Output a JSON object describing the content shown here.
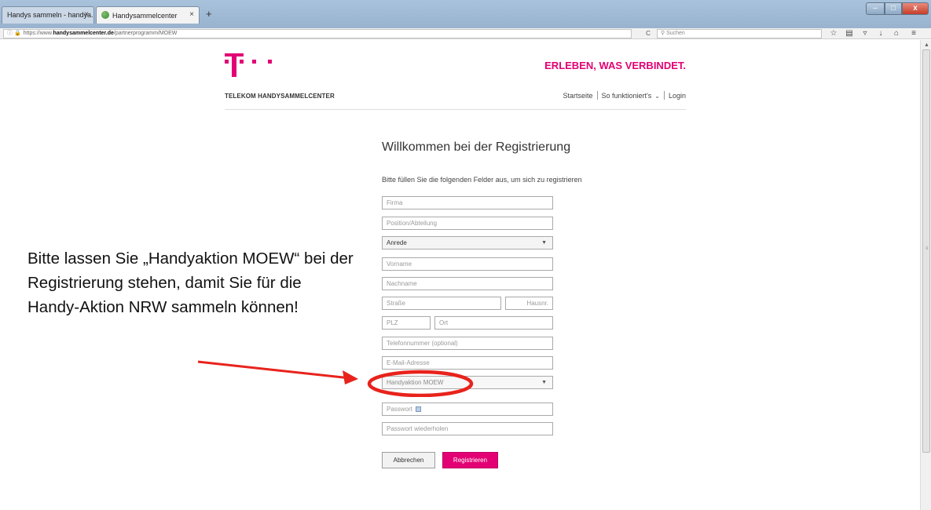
{
  "browser": {
    "tabs": [
      {
        "label": "Handys sammeln - handya...",
        "close": "×"
      },
      {
        "label": "Handysammelcenter",
        "close": "×"
      }
    ],
    "new_tab": "+",
    "window": {
      "minimize": "–",
      "maximize": "□",
      "close": "x"
    },
    "url_prefix": "https://www.",
    "url_domain": "handysammelcenter.de",
    "url_path": "/partnerprogramm/MOEW",
    "reload": "C",
    "search_placeholder": "Suchen"
  },
  "header": {
    "tagline": "ERLEBEN, WAS VERBINDET.",
    "brand": "TELEKOM HANDYSAMMELCENTER",
    "nav": {
      "home": "Startseite",
      "how": "So funktioniert's",
      "login": "Login"
    }
  },
  "form": {
    "title": "Willkommen bei der Registrierung",
    "subtitle": "Bitte füllen Sie die folgenden Felder aus, um sich zu registrieren",
    "company_placeholder": "Firma",
    "position_placeholder": "Position/Abteilung",
    "salutation_value": "Anrede",
    "firstname_placeholder": "Vorname",
    "lastname_placeholder": "Nachname",
    "street_placeholder": "Straße",
    "housenr_placeholder": "Hausnr.",
    "zip_placeholder": "PLZ",
    "city_placeholder": "Ort",
    "phone_placeholder": "Telefonnummer (optional)",
    "email_placeholder": "E-Mail-Adresse",
    "campaign_value": "Handyaktion MOEW",
    "password_placeholder": "Passwort",
    "password_repeat_placeholder": "Passwort wiederholen",
    "cancel_label": "Abbrechen",
    "register_label": "Registrieren"
  },
  "annotation": {
    "text": "Bitte lassen Sie „Handyaktion MOEW“ bei der Registrierung stehen, damit Sie für die Handy-Aktion NRW sammeln können!"
  },
  "colors": {
    "brand_magenta": "#e20074",
    "annotation_red": "#e8231c"
  }
}
